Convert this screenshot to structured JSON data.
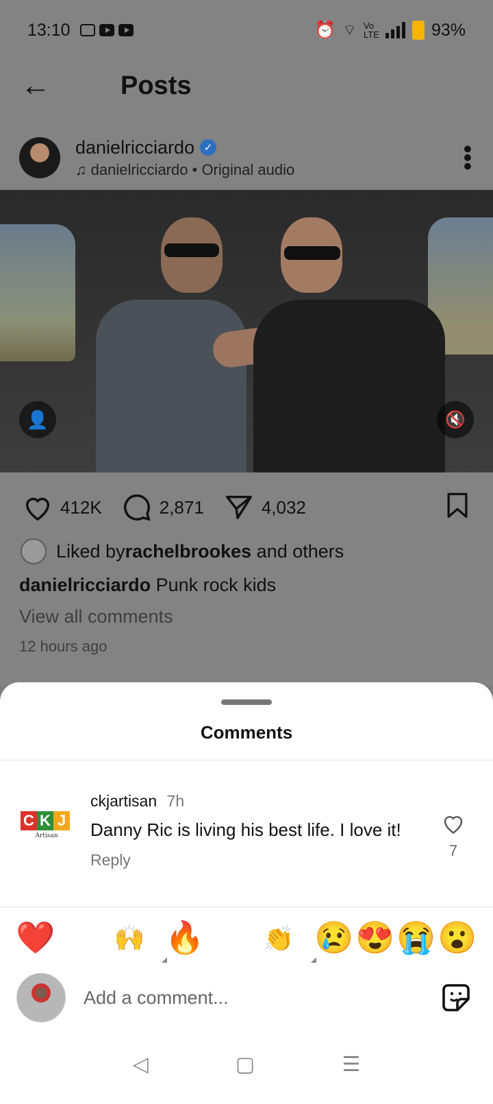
{
  "status_bar": {
    "time": "13:10",
    "network": "Vo LTE",
    "battery": "93%",
    "icons": [
      "calendar-icon",
      "youtube-icon",
      "youtube-icon",
      "alarm-icon",
      "wifi-icon",
      "signal-icon",
      "battery-icon"
    ]
  },
  "header": {
    "title": "Posts",
    "back_icon": "arrow-left-icon"
  },
  "post": {
    "username": "danielricciardo",
    "audio_user": "danielricciardo",
    "audio_label": "Original audio",
    "likes": "412K",
    "comments": "2,871",
    "shares": "4,032",
    "liked_by_prefix": "Liked by ",
    "liked_by_user": "rachelbrookes",
    "liked_by_suffix": " and others",
    "caption_user": "danielricciardo",
    "caption_text": "Punk rock kids",
    "view_all": "View all comments",
    "time_ago": "12 hours ago"
  },
  "comments_sheet": {
    "title": "Comments",
    "comment": {
      "user": "ckjartisan",
      "time": "7h",
      "text": "Danny Ric is living his best life. I love it!",
      "reply_label": "Reply",
      "like_count": "7",
      "logo_letters": [
        "C",
        "K",
        "J"
      ],
      "logo_sub": "Artisan",
      "logo_colors": [
        "#d9342b",
        "#2e8f3b",
        "#f2a71b"
      ]
    },
    "emojis": [
      "❤️",
      "🙌",
      "🔥",
      "👏",
      "😢",
      "😍",
      "😭",
      "😮"
    ],
    "compose_placeholder": "Add a comment..."
  },
  "nav": {
    "back": "◁",
    "home": "▢",
    "menu": "☰"
  }
}
